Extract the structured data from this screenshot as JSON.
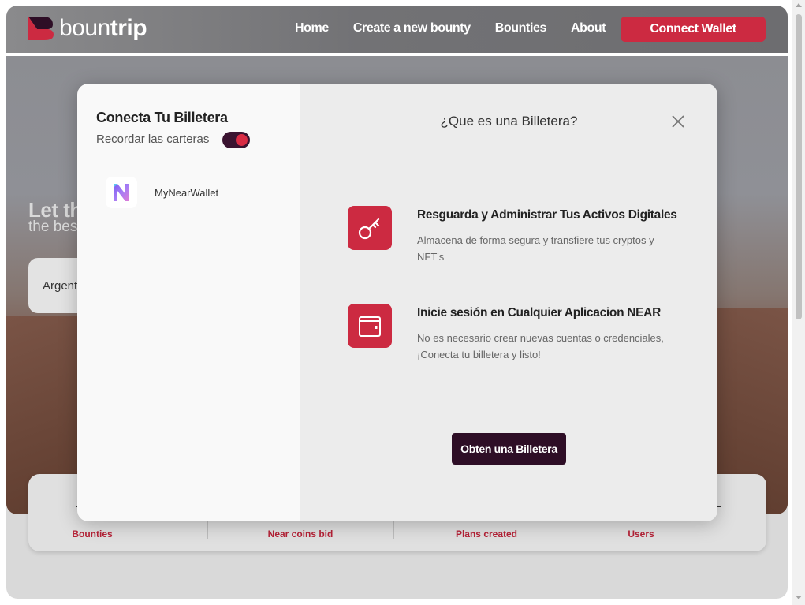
{
  "brand": {
    "name_light": "boun",
    "name_bold": "trip",
    "accent": "#cc2a41",
    "dark": "#2e0e26"
  },
  "nav": {
    "links": [
      "Home",
      "Create a new bounty",
      "Bounties",
      "About"
    ],
    "connect_label": "Connect Wallet"
  },
  "hero": {
    "title_partial": "Let th",
    "subtitle_partial": "the bes",
    "search_value_partial": "Argent"
  },
  "stats": {
    "labels": [
      "Bounties",
      "Near coins bid",
      "Plans created",
      "Users"
    ]
  },
  "modal": {
    "left": {
      "title": "Conecta Tu Billetera",
      "remember_label": "Recordar las carteras",
      "remember_on": true,
      "wallets": [
        {
          "name": "MyNearWallet",
          "icon": "near-wallet-icon"
        }
      ]
    },
    "right": {
      "title": "¿Que es una Billetera?",
      "features": [
        {
          "icon": "key-icon",
          "title": "Resguarda y Administrar Tus Activos Digitales",
          "description": "Almacena de forma segura y transfiere tus cryptos y NFT's"
        },
        {
          "icon": "wallet-icon",
          "title": "Inicie sesión en Cualquier Aplicacion NEAR",
          "description": "No es necesario crear nuevas cuentas o credenciales, ¡Conecta tu billetera y listo!"
        }
      ],
      "cta_label": "Obten una Billetera"
    }
  }
}
